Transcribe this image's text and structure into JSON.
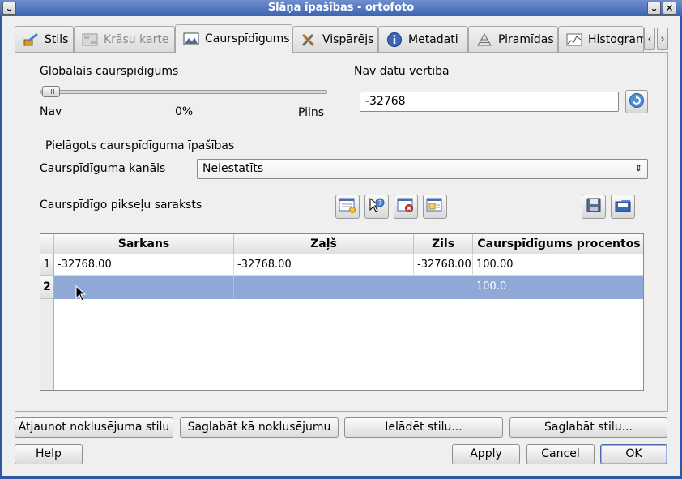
{
  "window": {
    "title": "Slāņa īpašības - ortofoto",
    "menu_glyph": "⌄",
    "collapse_glyph": "⌄",
    "close_glyph": "✕"
  },
  "tabs": [
    {
      "label": "Stils",
      "icon": "paintbrush-icon",
      "state": "normal"
    },
    {
      "label": "Krāsu karte",
      "icon": "colormap-icon",
      "state": "disabled"
    },
    {
      "label": "Caurspīdīgums",
      "icon": "transparency-icon",
      "state": "active"
    },
    {
      "label": "Vispārējs",
      "icon": "tools-icon",
      "state": "normal"
    },
    {
      "label": "Metadati",
      "icon": "info-icon",
      "state": "normal"
    },
    {
      "label": "Piramīdas",
      "icon": "pyramid-icon",
      "state": "normal"
    },
    {
      "label": "Histogram",
      "icon": "histogram-icon",
      "state": "normal"
    }
  ],
  "tab_scroll": {
    "left": "‹",
    "right": "›"
  },
  "global_transparency": {
    "label": "Globālais caurspīdīgums",
    "min_label": "Nav",
    "value_label": "0%",
    "max_label": "Pilns",
    "value_percent": 0
  },
  "nodata": {
    "label": "Nav datu vērtība",
    "value": "-32768",
    "reset_icon": "reset-icon"
  },
  "custom": {
    "section_label": "Pielāgots caurspīdīguma īpašības",
    "band_label": "Caurspīdīguma kanāls",
    "band_value": "Neiestatīts",
    "list_label": "Caurspīdīgo pikseļu saraksts",
    "tool_icons": [
      "add-row-icon",
      "pick-pixel-icon",
      "remove-row-icon",
      "default-values-icon",
      "save-file-icon",
      "open-file-icon"
    ]
  },
  "table": {
    "columns": [
      "Sarkans",
      "Zaļš",
      "Zils",
      "Caurspīdīgums procentos"
    ],
    "rows": [
      {
        "num": "1",
        "cells": [
          "-32768.00",
          "-32768.00",
          "-32768.00",
          "100.00"
        ],
        "selected": false
      },
      {
        "num": "2",
        "cells": [
          "",
          "",
          "",
          "100.0"
        ],
        "selected": true
      }
    ]
  },
  "style_buttons": {
    "restore": "Atjaunot noklusējuma stilu",
    "save_default": "Saglabāt kā noklusējumu",
    "load": "Ielādēt stilu...",
    "save": "Saglabāt stilu..."
  },
  "dialog_buttons": {
    "help": "Help",
    "apply": "Apply",
    "cancel": "Cancel",
    "ok": "OK"
  },
  "colors": {
    "selection": "#8fa8d6",
    "titlebar": "#3c63b0",
    "accent": "#4a6ab0"
  }
}
